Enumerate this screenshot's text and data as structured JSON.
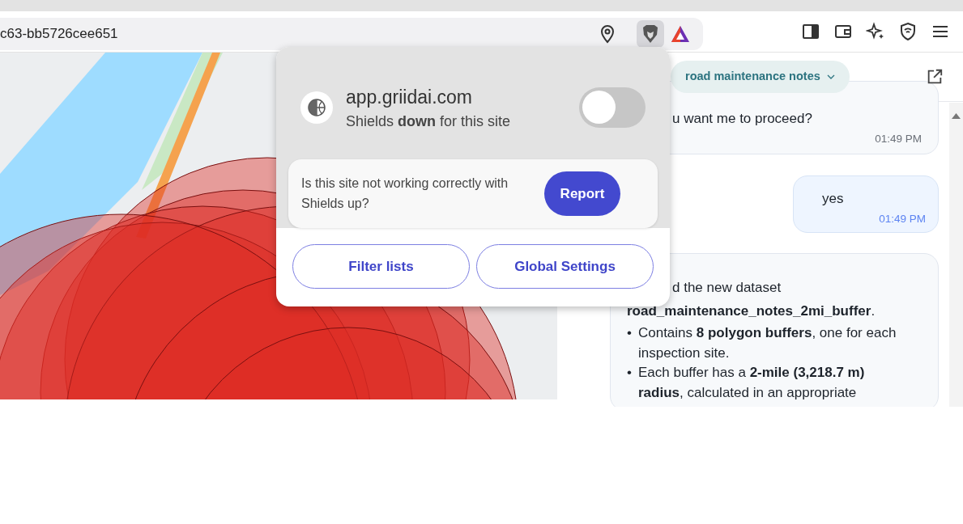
{
  "browser": {
    "address": "c63-bb5726cee651"
  },
  "chat": {
    "dataset_selector": "road maintenance notes",
    "messages": [
      {
        "kind": "received",
        "paragraphs": [
          "u want me to proceed?"
        ],
        "time": "01:49 PM"
      },
      {
        "kind": "sent",
        "paragraphs": [
          "yes"
        ],
        "time": "01:49 PM"
      },
      {
        "kind": "received",
        "paragraphs": [
          "d the new dataset **road_maintenance_notes_2mi_buffer**."
        ],
        "bullets": [
          {
            "marker": "•",
            "text": "Contains **8 polygon buffers**, one for each inspection site."
          },
          {
            "marker": "•",
            "text": "Each buffer has a **2-mile (3,218.7 m) radius**, calculated in an appropriate"
          }
        ]
      }
    ]
  },
  "shields_popup": {
    "site": "app.griidai.com",
    "status": "Shields **down** for this site",
    "shields_on": false,
    "prompt": "Is this site not working correctly with Shields up?",
    "report_button": "Report",
    "buttons": [
      "Filter lists",
      "Global Settings"
    ]
  }
}
